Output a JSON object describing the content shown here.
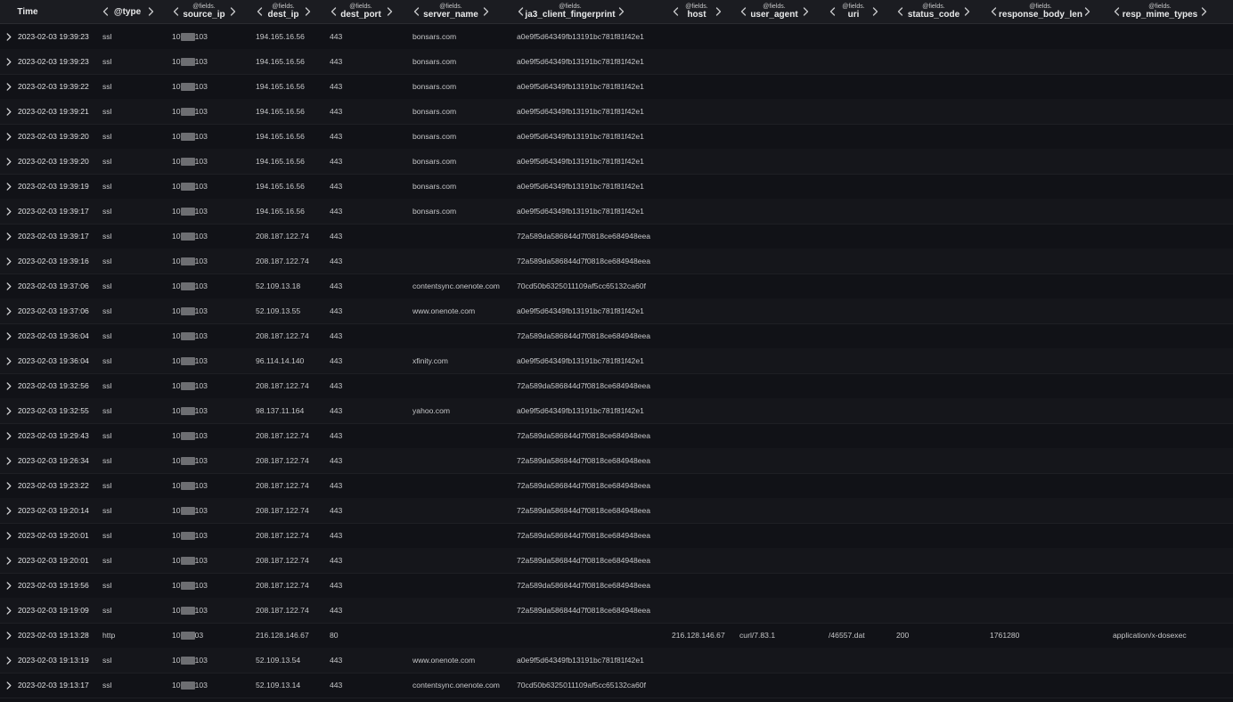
{
  "columns": [
    {
      "key": "time",
      "prefix": "",
      "label": "Time"
    },
    {
      "key": "type",
      "prefix": "",
      "label": "@type"
    },
    {
      "key": "source_ip",
      "prefix": "@fields.",
      "label": "source_ip"
    },
    {
      "key": "dest_ip",
      "prefix": "@fields.",
      "label": "dest_ip"
    },
    {
      "key": "dest_port",
      "prefix": "@fields.",
      "label": "dest_port"
    },
    {
      "key": "server_name",
      "prefix": "@fields.",
      "label": "server_name"
    },
    {
      "key": "ja3",
      "prefix": "@fields.",
      "label": "ja3_client_fingerprint"
    },
    {
      "key": "host",
      "prefix": "@fields.",
      "label": "host"
    },
    {
      "key": "user_agent",
      "prefix": "@fields.",
      "label": "user_agent"
    },
    {
      "key": "uri",
      "prefix": "@fields.",
      "label": "uri"
    },
    {
      "key": "status_code",
      "prefix": "@fields.",
      "label": "status_code"
    },
    {
      "key": "response_body_len",
      "prefix": "@fields.",
      "label": "response_body_len"
    },
    {
      "key": "resp_mime_types",
      "prefix": "@fields.",
      "label": "resp_mime_types"
    }
  ],
  "rows": [
    {
      "time": "2023-02-03 19:39:23",
      "type": "ssl",
      "src_prefix": "10",
      "src_suffix": "103",
      "dest_ip": "194.165.16.56",
      "dest_port": "443",
      "server_name": "bonsars.com",
      "ja3": "a0e9f5d64349fb13191bc781f81f42e1",
      "host": "",
      "user_agent": "",
      "uri": "",
      "status_code": "",
      "response_body_len": "",
      "resp_mime_types": ""
    },
    {
      "time": "2023-02-03 19:39:23",
      "type": "ssl",
      "src_prefix": "10",
      "src_suffix": "103",
      "dest_ip": "194.165.16.56",
      "dest_port": "443",
      "server_name": "bonsars.com",
      "ja3": "a0e9f5d64349fb13191bc781f81f42e1",
      "host": "",
      "user_agent": "",
      "uri": "",
      "status_code": "",
      "response_body_len": "",
      "resp_mime_types": ""
    },
    {
      "time": "2023-02-03 19:39:22",
      "type": "ssl",
      "src_prefix": "10",
      "src_suffix": "103",
      "dest_ip": "194.165.16.56",
      "dest_port": "443",
      "server_name": "bonsars.com",
      "ja3": "a0e9f5d64349fb13191bc781f81f42e1",
      "host": "",
      "user_agent": "",
      "uri": "",
      "status_code": "",
      "response_body_len": "",
      "resp_mime_types": ""
    },
    {
      "time": "2023-02-03 19:39:21",
      "type": "ssl",
      "src_prefix": "10",
      "src_suffix": "103",
      "dest_ip": "194.165.16.56",
      "dest_port": "443",
      "server_name": "bonsars.com",
      "ja3": "a0e9f5d64349fb13191bc781f81f42e1",
      "host": "",
      "user_agent": "",
      "uri": "",
      "status_code": "",
      "response_body_len": "",
      "resp_mime_types": ""
    },
    {
      "time": "2023-02-03 19:39:20",
      "type": "ssl",
      "src_prefix": "10",
      "src_suffix": "103",
      "dest_ip": "194.165.16.56",
      "dest_port": "443",
      "server_name": "bonsars.com",
      "ja3": "a0e9f5d64349fb13191bc781f81f42e1",
      "host": "",
      "user_agent": "",
      "uri": "",
      "status_code": "",
      "response_body_len": "",
      "resp_mime_types": ""
    },
    {
      "time": "2023-02-03 19:39:20",
      "type": "ssl",
      "src_prefix": "10",
      "src_suffix": "103",
      "dest_ip": "194.165.16.56",
      "dest_port": "443",
      "server_name": "bonsars.com",
      "ja3": "a0e9f5d64349fb13191bc781f81f42e1",
      "host": "",
      "user_agent": "",
      "uri": "",
      "status_code": "",
      "response_body_len": "",
      "resp_mime_types": ""
    },
    {
      "time": "2023-02-03 19:39:19",
      "type": "ssl",
      "src_prefix": "10",
      "src_suffix": "103",
      "dest_ip": "194.165.16.56",
      "dest_port": "443",
      "server_name": "bonsars.com",
      "ja3": "a0e9f5d64349fb13191bc781f81f42e1",
      "host": "",
      "user_agent": "",
      "uri": "",
      "status_code": "",
      "response_body_len": "",
      "resp_mime_types": ""
    },
    {
      "time": "2023-02-03 19:39:17",
      "type": "ssl",
      "src_prefix": "10",
      "src_suffix": "103",
      "dest_ip": "194.165.16.56",
      "dest_port": "443",
      "server_name": "bonsars.com",
      "ja3": "a0e9f5d64349fb13191bc781f81f42e1",
      "host": "",
      "user_agent": "",
      "uri": "",
      "status_code": "",
      "response_body_len": "",
      "resp_mime_types": ""
    },
    {
      "time": "2023-02-03 19:39:17",
      "type": "ssl",
      "src_prefix": "10",
      "src_suffix": "103",
      "dest_ip": "208.187.122.74",
      "dest_port": "443",
      "server_name": "",
      "ja3": "72a589da586844d7f0818ce684948eea",
      "host": "",
      "user_agent": "",
      "uri": "",
      "status_code": "",
      "response_body_len": "",
      "resp_mime_types": ""
    },
    {
      "time": "2023-02-03 19:39:16",
      "type": "ssl",
      "src_prefix": "10",
      "src_suffix": "103",
      "dest_ip": "208.187.122.74",
      "dest_port": "443",
      "server_name": "",
      "ja3": "72a589da586844d7f0818ce684948eea",
      "host": "",
      "user_agent": "",
      "uri": "",
      "status_code": "",
      "response_body_len": "",
      "resp_mime_types": ""
    },
    {
      "time": "2023-02-03 19:37:06",
      "type": "ssl",
      "src_prefix": "10",
      "src_suffix": "103",
      "dest_ip": "52.109.13.18",
      "dest_port": "443",
      "server_name": "contentsync.onenote.com",
      "ja3": "70cd50b6325011109af5cc65132ca60f",
      "host": "",
      "user_agent": "",
      "uri": "",
      "status_code": "",
      "response_body_len": "",
      "resp_mime_types": ""
    },
    {
      "time": "2023-02-03 19:37:06",
      "type": "ssl",
      "src_prefix": "10",
      "src_suffix": "103",
      "dest_ip": "52.109.13.55",
      "dest_port": "443",
      "server_name": "www.onenote.com",
      "ja3": "a0e9f5d64349fb13191bc781f81f42e1",
      "host": "",
      "user_agent": "",
      "uri": "",
      "status_code": "",
      "response_body_len": "",
      "resp_mime_types": ""
    },
    {
      "time": "2023-02-03 19:36:04",
      "type": "ssl",
      "src_prefix": "10",
      "src_suffix": "103",
      "dest_ip": "208.187.122.74",
      "dest_port": "443",
      "server_name": "",
      "ja3": "72a589da586844d7f0818ce684948eea",
      "host": "",
      "user_agent": "",
      "uri": "",
      "status_code": "",
      "response_body_len": "",
      "resp_mime_types": ""
    },
    {
      "time": "2023-02-03 19:36:04",
      "type": "ssl",
      "src_prefix": "10",
      "src_suffix": "103",
      "dest_ip": "96.114.14.140",
      "dest_port": "443",
      "server_name": "xfinity.com",
      "ja3": "a0e9f5d64349fb13191bc781f81f42e1",
      "host": "",
      "user_agent": "",
      "uri": "",
      "status_code": "",
      "response_body_len": "",
      "resp_mime_types": ""
    },
    {
      "time": "2023-02-03 19:32:56",
      "type": "ssl",
      "src_prefix": "10",
      "src_suffix": "103",
      "dest_ip": "208.187.122.74",
      "dest_port": "443",
      "server_name": "",
      "ja3": "72a589da586844d7f0818ce684948eea",
      "host": "",
      "user_agent": "",
      "uri": "",
      "status_code": "",
      "response_body_len": "",
      "resp_mime_types": ""
    },
    {
      "time": "2023-02-03 19:32:55",
      "type": "ssl",
      "src_prefix": "10",
      "src_suffix": "103",
      "dest_ip": "98.137.11.164",
      "dest_port": "443",
      "server_name": "yahoo.com",
      "ja3": "a0e9f5d64349fb13191bc781f81f42e1",
      "host": "",
      "user_agent": "",
      "uri": "",
      "status_code": "",
      "response_body_len": "",
      "resp_mime_types": ""
    },
    {
      "time": "2023-02-03 19:29:43",
      "type": "ssl",
      "src_prefix": "10",
      "src_suffix": "103",
      "dest_ip": "208.187.122.74",
      "dest_port": "443",
      "server_name": "",
      "ja3": "72a589da586844d7f0818ce684948eea",
      "host": "",
      "user_agent": "",
      "uri": "",
      "status_code": "",
      "response_body_len": "",
      "resp_mime_types": ""
    },
    {
      "time": "2023-02-03 19:26:34",
      "type": "ssl",
      "src_prefix": "10",
      "src_suffix": "103",
      "dest_ip": "208.187.122.74",
      "dest_port": "443",
      "server_name": "",
      "ja3": "72a589da586844d7f0818ce684948eea",
      "host": "",
      "user_agent": "",
      "uri": "",
      "status_code": "",
      "response_body_len": "",
      "resp_mime_types": ""
    },
    {
      "time": "2023-02-03 19:23:22",
      "type": "ssl",
      "src_prefix": "10",
      "src_suffix": "103",
      "dest_ip": "208.187.122.74",
      "dest_port": "443",
      "server_name": "",
      "ja3": "72a589da586844d7f0818ce684948eea",
      "host": "",
      "user_agent": "",
      "uri": "",
      "status_code": "",
      "response_body_len": "",
      "resp_mime_types": ""
    },
    {
      "time": "2023-02-03 19:20:14",
      "type": "ssl",
      "src_prefix": "10",
      "src_suffix": "103",
      "dest_ip": "208.187.122.74",
      "dest_port": "443",
      "server_name": "",
      "ja3": "72a589da586844d7f0818ce684948eea",
      "host": "",
      "user_agent": "",
      "uri": "",
      "status_code": "",
      "response_body_len": "",
      "resp_mime_types": ""
    },
    {
      "time": "2023-02-03 19:20:01",
      "type": "ssl",
      "src_prefix": "10",
      "src_suffix": "103",
      "dest_ip": "208.187.122.74",
      "dest_port": "443",
      "server_name": "",
      "ja3": "72a589da586844d7f0818ce684948eea",
      "host": "",
      "user_agent": "",
      "uri": "",
      "status_code": "",
      "response_body_len": "",
      "resp_mime_types": ""
    },
    {
      "time": "2023-02-03 19:20:01",
      "type": "ssl",
      "src_prefix": "10",
      "src_suffix": "103",
      "dest_ip": "208.187.122.74",
      "dest_port": "443",
      "server_name": "",
      "ja3": "72a589da586844d7f0818ce684948eea",
      "host": "",
      "user_agent": "",
      "uri": "",
      "status_code": "",
      "response_body_len": "",
      "resp_mime_types": ""
    },
    {
      "time": "2023-02-03 19:19:56",
      "type": "ssl",
      "src_prefix": "10",
      "src_suffix": "103",
      "dest_ip": "208.187.122.74",
      "dest_port": "443",
      "server_name": "",
      "ja3": "72a589da586844d7f0818ce684948eea",
      "host": "",
      "user_agent": "",
      "uri": "",
      "status_code": "",
      "response_body_len": "",
      "resp_mime_types": ""
    },
    {
      "time": "2023-02-03 19:19:09",
      "type": "ssl",
      "src_prefix": "10",
      "src_suffix": "103",
      "dest_ip": "208.187.122.74",
      "dest_port": "443",
      "server_name": "",
      "ja3": "72a589da586844d7f0818ce684948eea",
      "host": "",
      "user_agent": "",
      "uri": "",
      "status_code": "",
      "response_body_len": "",
      "resp_mime_types": ""
    },
    {
      "time": "2023-02-03 19:13:28",
      "type": "http",
      "src_prefix": "10",
      "src_suffix": "03",
      "dest_ip": "216.128.146.67",
      "dest_port": "80",
      "server_name": "",
      "ja3": "",
      "host": "216.128.146.67",
      "user_agent": "curl/7.83.1",
      "uri": "/46557.dat",
      "status_code": "200",
      "response_body_len": "1761280",
      "resp_mime_types": "application/x-dosexec"
    },
    {
      "time": "2023-02-03 19:13:19",
      "type": "ssl",
      "src_prefix": "10",
      "src_suffix": "103",
      "dest_ip": "52.109.13.54",
      "dest_port": "443",
      "server_name": "www.onenote.com",
      "ja3": "a0e9f5d64349fb13191bc781f81f42e1",
      "host": "",
      "user_agent": "",
      "uri": "",
      "status_code": "",
      "response_body_len": "",
      "resp_mime_types": ""
    },
    {
      "time": "2023-02-03 19:13:17",
      "type": "ssl",
      "src_prefix": "10",
      "src_suffix": "103",
      "dest_ip": "52.109.13.14",
      "dest_port": "443",
      "server_name": "contentsync.onenote.com",
      "ja3": "70cd50b6325011109af5cc65132ca60f",
      "host": "",
      "user_agent": "",
      "uri": "",
      "status_code": "",
      "response_body_len": "",
      "resp_mime_types": ""
    }
  ],
  "colors": {
    "background": "#111217",
    "header": "#1b1c21",
    "text": "#c6c7c9",
    "redaction": "#6d6e72"
  },
  "icons": {
    "row_expand": "chevron-right-icon",
    "column_move_left": "chevron-left-icon",
    "column_move_right": "chevron-right-icon"
  }
}
